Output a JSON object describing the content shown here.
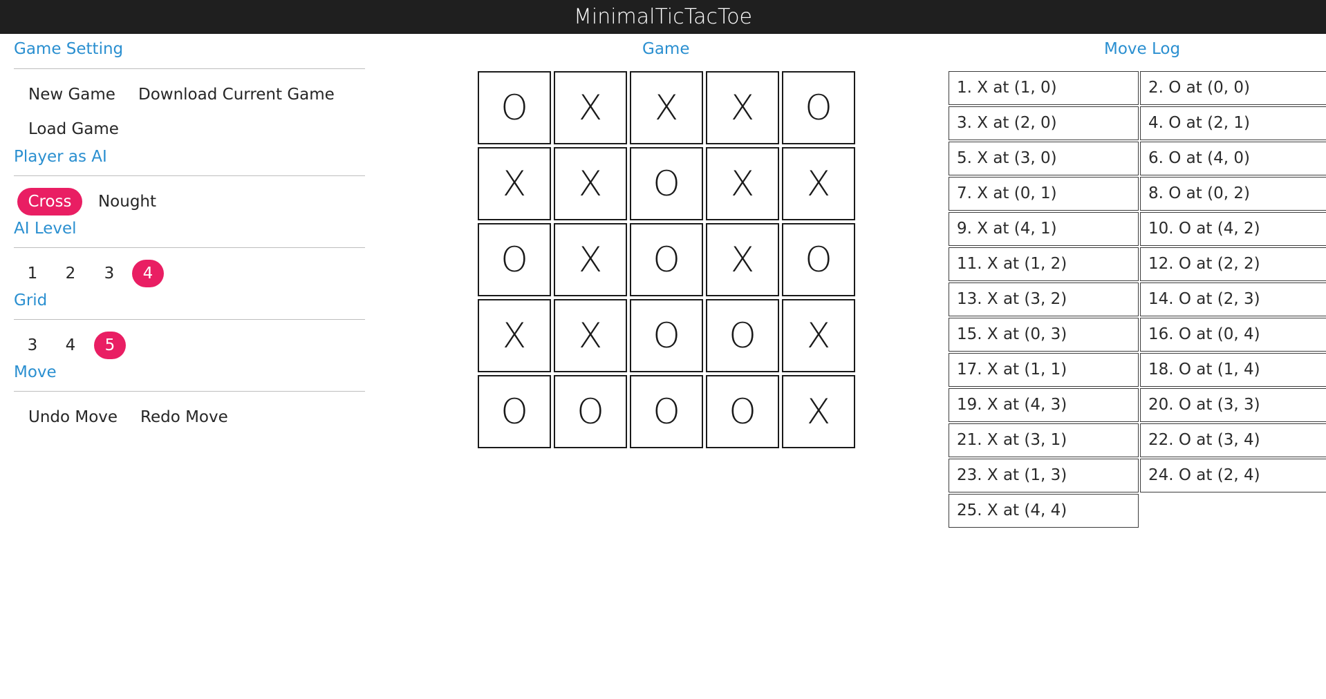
{
  "app": {
    "title": "MinimalTicTacToe"
  },
  "settings": {
    "title": "Game Setting",
    "new_game": "New Game",
    "download_game": "Download Current Game",
    "load_game": "Load Game",
    "player_ai_title": "Player as AI",
    "player_options": [
      "Cross",
      "Nought"
    ],
    "player_selected": "Cross",
    "ai_level_title": "AI Level",
    "ai_levels": [
      "1",
      "2",
      "3",
      "4"
    ],
    "ai_level_selected": "4",
    "grid_title": "Grid",
    "grid_options": [
      "3",
      "4",
      "5"
    ],
    "grid_selected": "5",
    "move_title": "Move",
    "undo_move": "Undo Move",
    "redo_move": "Redo Move"
  },
  "game": {
    "title": "Game",
    "board": [
      [
        "O",
        "X",
        "X",
        "X",
        "O"
      ],
      [
        "X",
        "X",
        "O",
        "X",
        "X"
      ],
      [
        "O",
        "X",
        "O",
        "X",
        "O"
      ],
      [
        "X",
        "X",
        "O",
        "O",
        "X"
      ],
      [
        "O",
        "O",
        "O",
        "O",
        "X"
      ]
    ]
  },
  "move_log": {
    "title": "Move Log",
    "entries": [
      "1. X at (1, 0)",
      "2. O at (0, 0)",
      "3. X at (2, 0)",
      "4. O at (2, 1)",
      "5. X at (3, 0)",
      "6. O at (4, 0)",
      "7. X at (0, 1)",
      "8. O at (0, 2)",
      "9. X at (4, 1)",
      "10. O at (4, 2)",
      "11. X at (1, 2)",
      "12. O at (2, 2)",
      "13. X at (3, 2)",
      "14. O at (2, 3)",
      "15. X at (0, 3)",
      "16. O at (0, 4)",
      "17. X at (1, 1)",
      "18. O at (1, 4)",
      "19. X at (4, 3)",
      "20. O at (3, 3)",
      "21. X at (3, 1)",
      "22. O at (3, 4)",
      "23. X at (1, 3)",
      "24. O at (2, 4)",
      "25. X at (4, 4)"
    ]
  },
  "colors": {
    "accent": "#e91e63",
    "link": "#2a8fd0",
    "topbar": "#1f1f1f"
  }
}
